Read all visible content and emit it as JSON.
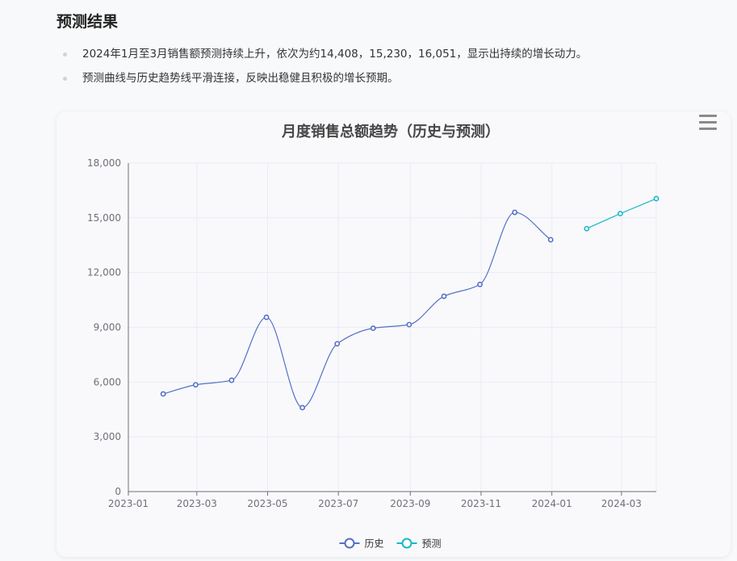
{
  "heading": "预测结果",
  "bullets": [
    "2024年1月至3月销售额预测持续上升，依次为约14,408，15,230，16,051，显示出持续的增长动力。",
    "预测曲线与历史趋势线平滑连接，反映出稳健且积极的增长预期。"
  ],
  "menu_icon": "hamburger-menu-icon",
  "chart_data": {
    "type": "line",
    "title": "月度销售总额趋势（历史与预测）",
    "xlabel": "",
    "ylabel": "",
    "ylim": [
      0,
      18000
    ],
    "yticks": [
      0,
      3000,
      6000,
      9000,
      12000,
      15000,
      18000
    ],
    "ytick_labels": [
      "0",
      "3,000",
      "6,000",
      "9,000",
      "12,000",
      "15,000",
      "18,000"
    ],
    "xticks": [
      "2023-01",
      "2023-03",
      "2023-05",
      "2023-07",
      "2023-09",
      "2023-11",
      "2024-01",
      "2024-03"
    ],
    "grid": true,
    "legend_position": "bottom-center",
    "series": [
      {
        "name": "历史",
        "color": "#5470c6",
        "smooth": true,
        "points": [
          {
            "x": "2023-01-31",
            "y": 5350
          },
          {
            "x": "2023-02-28",
            "y": 5850
          },
          {
            "x": "2023-03-31",
            "y": 6100
          },
          {
            "x": "2023-04-30",
            "y": 9550
          },
          {
            "x": "2023-05-31",
            "y": 4600
          },
          {
            "x": "2023-06-30",
            "y": 8100
          },
          {
            "x": "2023-07-31",
            "y": 8950
          },
          {
            "x": "2023-08-31",
            "y": 9150
          },
          {
            "x": "2023-09-30",
            "y": 10700
          },
          {
            "x": "2023-10-31",
            "y": 11350
          },
          {
            "x": "2023-11-30",
            "y": 15300
          },
          {
            "x": "2023-12-31",
            "y": 13800
          }
        ]
      },
      {
        "name": "预测",
        "color": "#1ab8c4",
        "smooth": false,
        "points": [
          {
            "x": "2024-01-31",
            "y": 14408
          },
          {
            "x": "2024-02-29",
            "y": 15230
          },
          {
            "x": "2024-03-31",
            "y": 16051
          }
        ]
      }
    ]
  }
}
